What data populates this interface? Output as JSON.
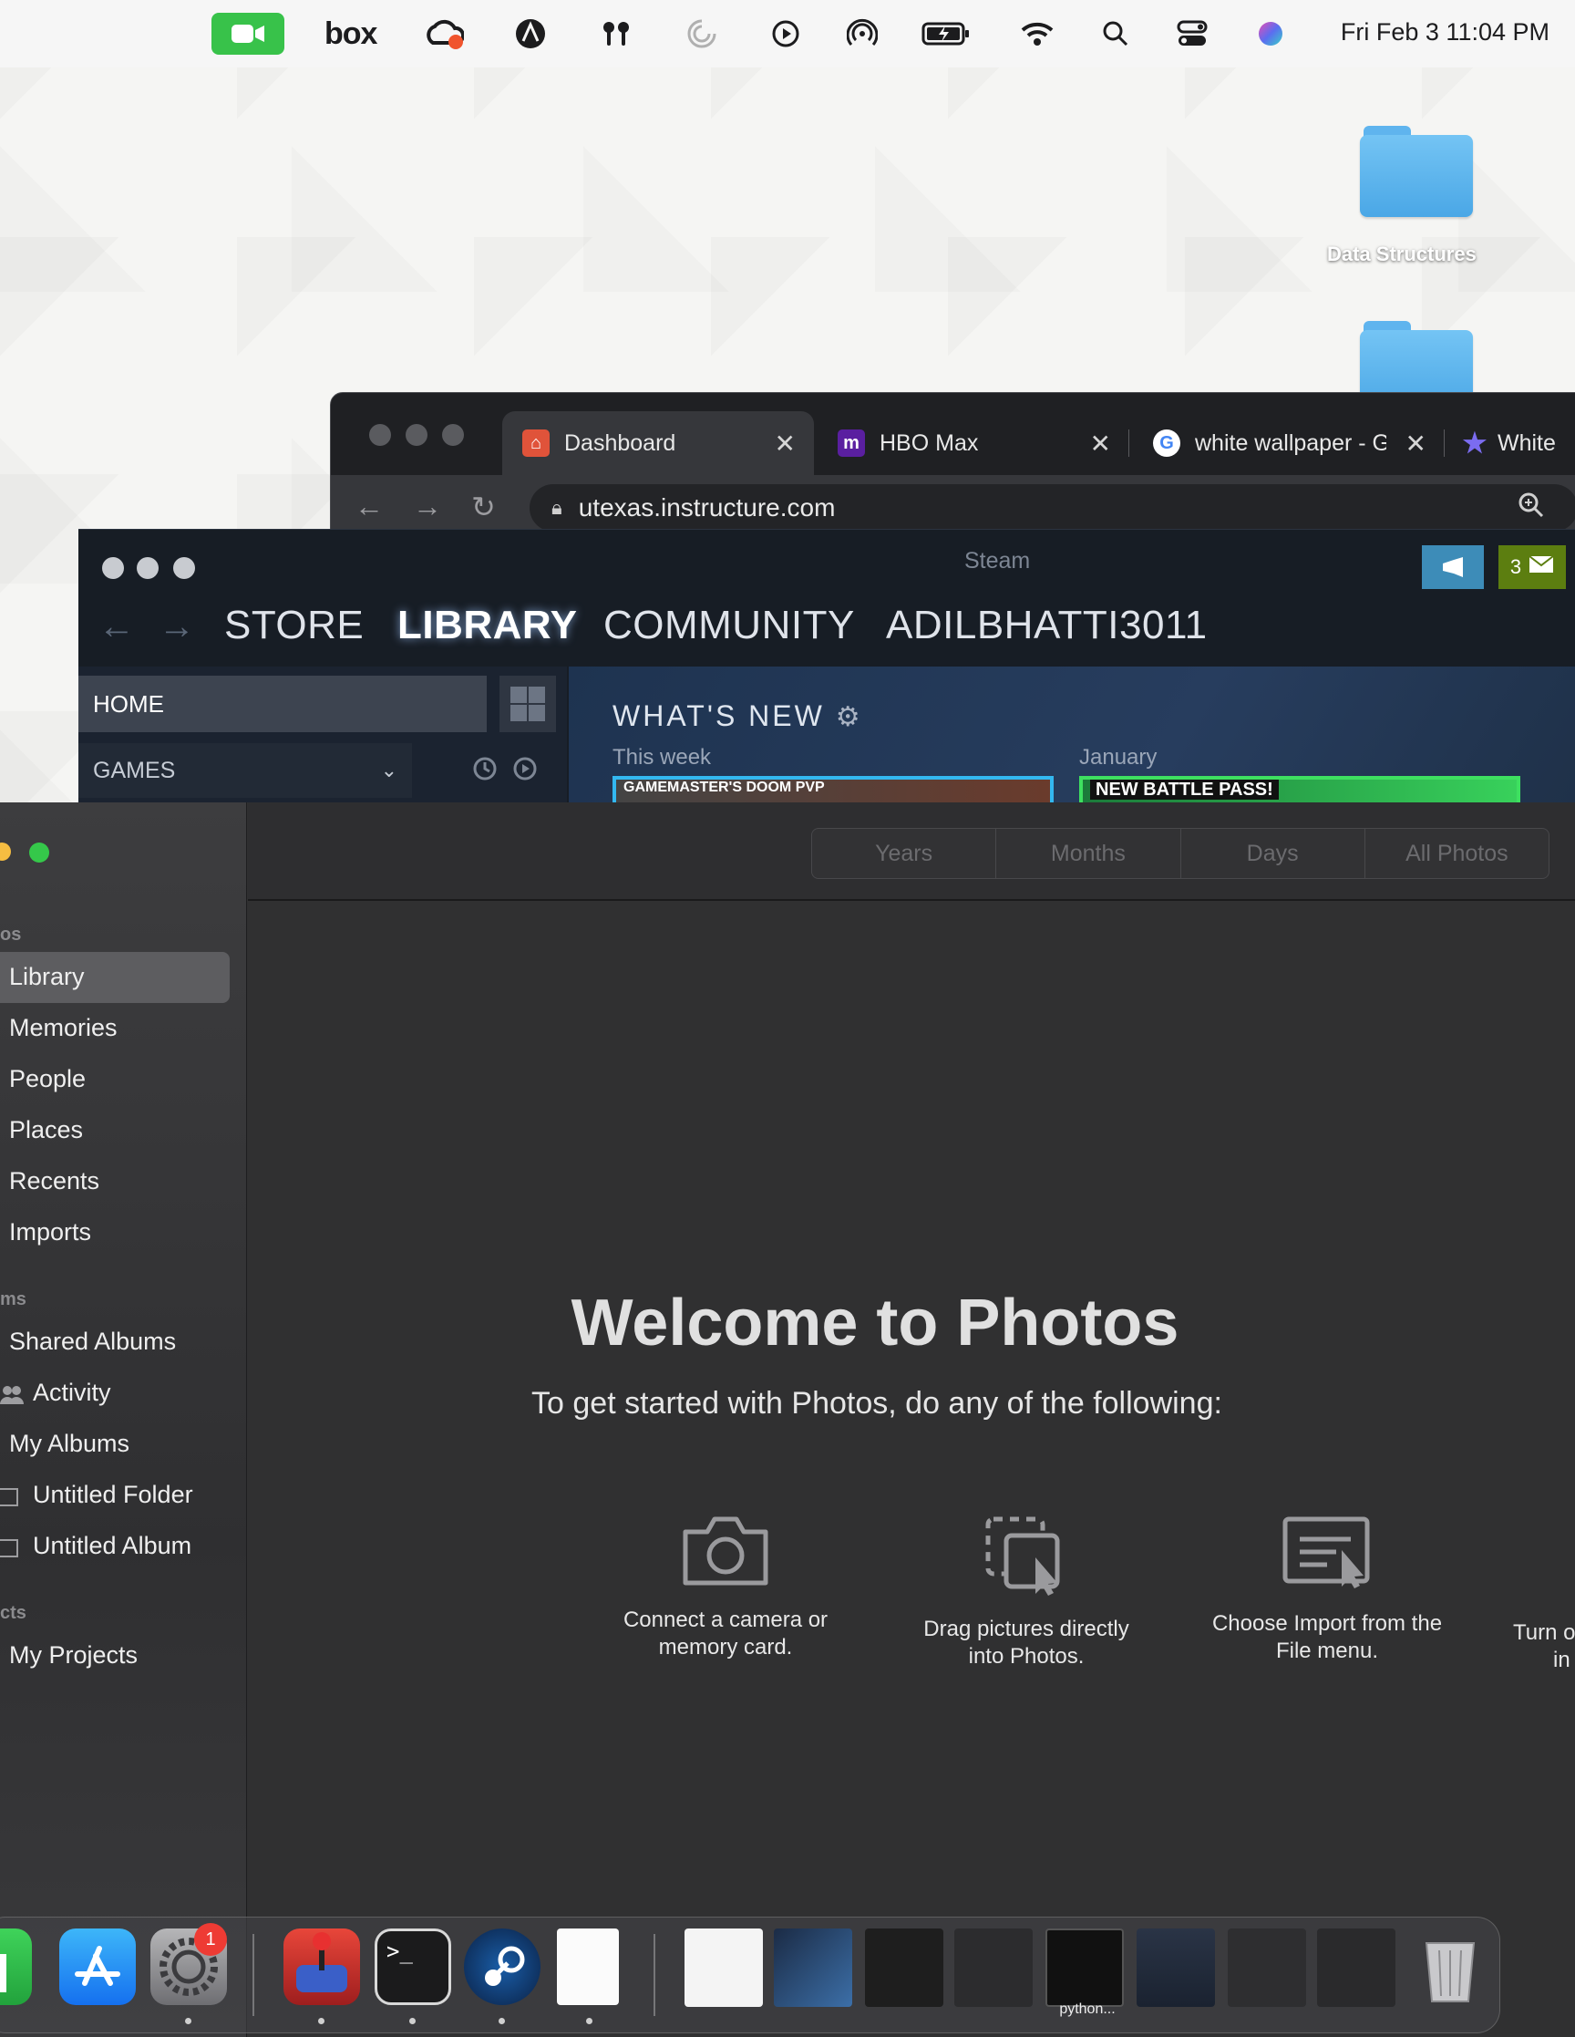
{
  "menubar": {
    "icons": [
      "facetime-icon",
      "box-icon",
      "creative-cloud-icon",
      "astro-icon",
      "airpods-icon",
      "focus-icon",
      "play-icon",
      "airdrop-icon",
      "battery-icon",
      "wifi-icon",
      "search-icon",
      "control-center-icon",
      "siri-icon"
    ],
    "box_label": "box",
    "clock": "Fri Feb 3  11:04 PM"
  },
  "desktop": {
    "folders": [
      {
        "label": "Data Structures"
      },
      {
        "label": ""
      }
    ]
  },
  "chrome": {
    "tabs": [
      {
        "title": "Dashboard",
        "icon": "canvas-icon"
      },
      {
        "title": "HBO Max",
        "icon": "hbo-max-icon",
        "favicon_text": "m"
      },
      {
        "title": "white wallpaper - G",
        "icon": "google-icon",
        "favicon_text": "G"
      },
      {
        "title": "White",
        "icon": "star-icon"
      }
    ],
    "close_glyph": "✕",
    "url": "utexas.instructure.com"
  },
  "steam": {
    "title": "Steam",
    "message_count": "3",
    "nav": {
      "store": "STORE",
      "library": "LIBRARY",
      "community": "COMMUNITY",
      "user": "ADILBHATTI3011"
    },
    "home": "HOME",
    "games": "GAMES",
    "whats_new": "WHAT'S NEW",
    "col1_label": "This week",
    "col2_label": "January",
    "card1_text": "GAMEMASTER'S DOOM PVP",
    "card2_text": "NEW BATTLE PASS!"
  },
  "photos": {
    "sidebar": {
      "section1": "os",
      "items1": [
        "Library",
        "Memories",
        "People",
        "Places",
        "Recents",
        "Imports"
      ],
      "section2": "ms",
      "items2": [
        "Shared Albums",
        "Activity",
        "My Albums",
        "Untitled Folder",
        "Untitled Album"
      ],
      "section3": "cts",
      "items3": [
        "My Projects"
      ]
    },
    "segments": [
      "Years",
      "Months",
      "Days",
      "All Photos"
    ],
    "welcome_title": "Welcome to Photos",
    "welcome_subtitle": "To get started with Photos, do any of the following:",
    "options": [
      {
        "line1": "Connect a camera or",
        "line2": "memory card."
      },
      {
        "line1": "Drag pictures directly",
        "line2": "into Photos."
      },
      {
        "line1": "Choose Import from the",
        "line2": "File menu."
      },
      {
        "line1": "Turn o",
        "line2": "in"
      }
    ]
  },
  "dock": {
    "badge_settings": "1",
    "thumbnail_label": "python..."
  },
  "colors": {
    "facetime_green": "#38c24a",
    "steam_bg": "#171d25",
    "photos_bg": "#303031",
    "folder_blue": "#5fb4ee"
  }
}
